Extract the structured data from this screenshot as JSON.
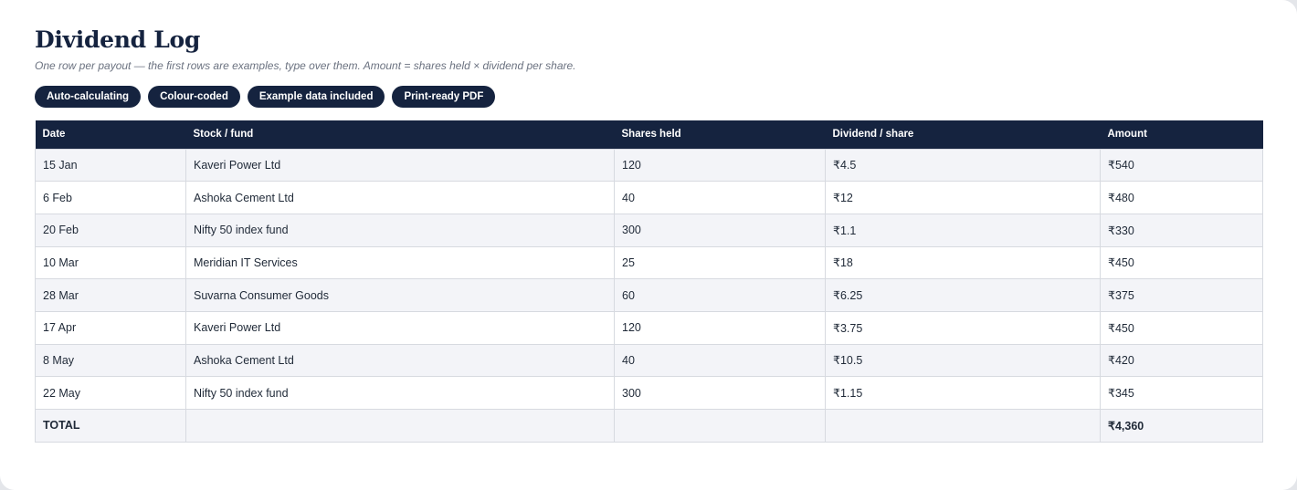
{
  "title": "Dividend Log",
  "subtitle": "One row per payout — the first rows are examples, type over them. Amount = shares held × dividend per share.",
  "pills": [
    "Auto-calculating",
    "Colour-coded",
    "Example data included",
    "Print-ready PDF"
  ],
  "table": {
    "headers": [
      "Date",
      "Stock / fund",
      "Shares held",
      "Dividend / share",
      "Amount"
    ],
    "rows": [
      [
        "15 Jan",
        "Kaveri Power Ltd",
        "120",
        "₹4.5",
        "₹540"
      ],
      [
        "6 Feb",
        "Ashoka Cement Ltd",
        "40",
        "₹12",
        "₹480"
      ],
      [
        "20 Feb",
        "Nifty 50 index fund",
        "300",
        "₹1.1",
        "₹330"
      ],
      [
        "10 Mar",
        "Meridian IT Services",
        "25",
        "₹18",
        "₹450"
      ],
      [
        "28 Mar",
        "Suvarna Consumer Goods",
        "60",
        "₹6.25",
        "₹375"
      ],
      [
        "17 Apr",
        "Kaveri Power Ltd",
        "120",
        "₹3.75",
        "₹450"
      ],
      [
        "8 May",
        "Ashoka Cement Ltd",
        "40",
        "₹10.5",
        "₹420"
      ],
      [
        "22 May",
        "Nifty 50 index fund",
        "300",
        "₹1.15",
        "₹345"
      ]
    ],
    "total": [
      "TOTAL",
      "",
      "",
      "",
      "₹4,360"
    ]
  }
}
